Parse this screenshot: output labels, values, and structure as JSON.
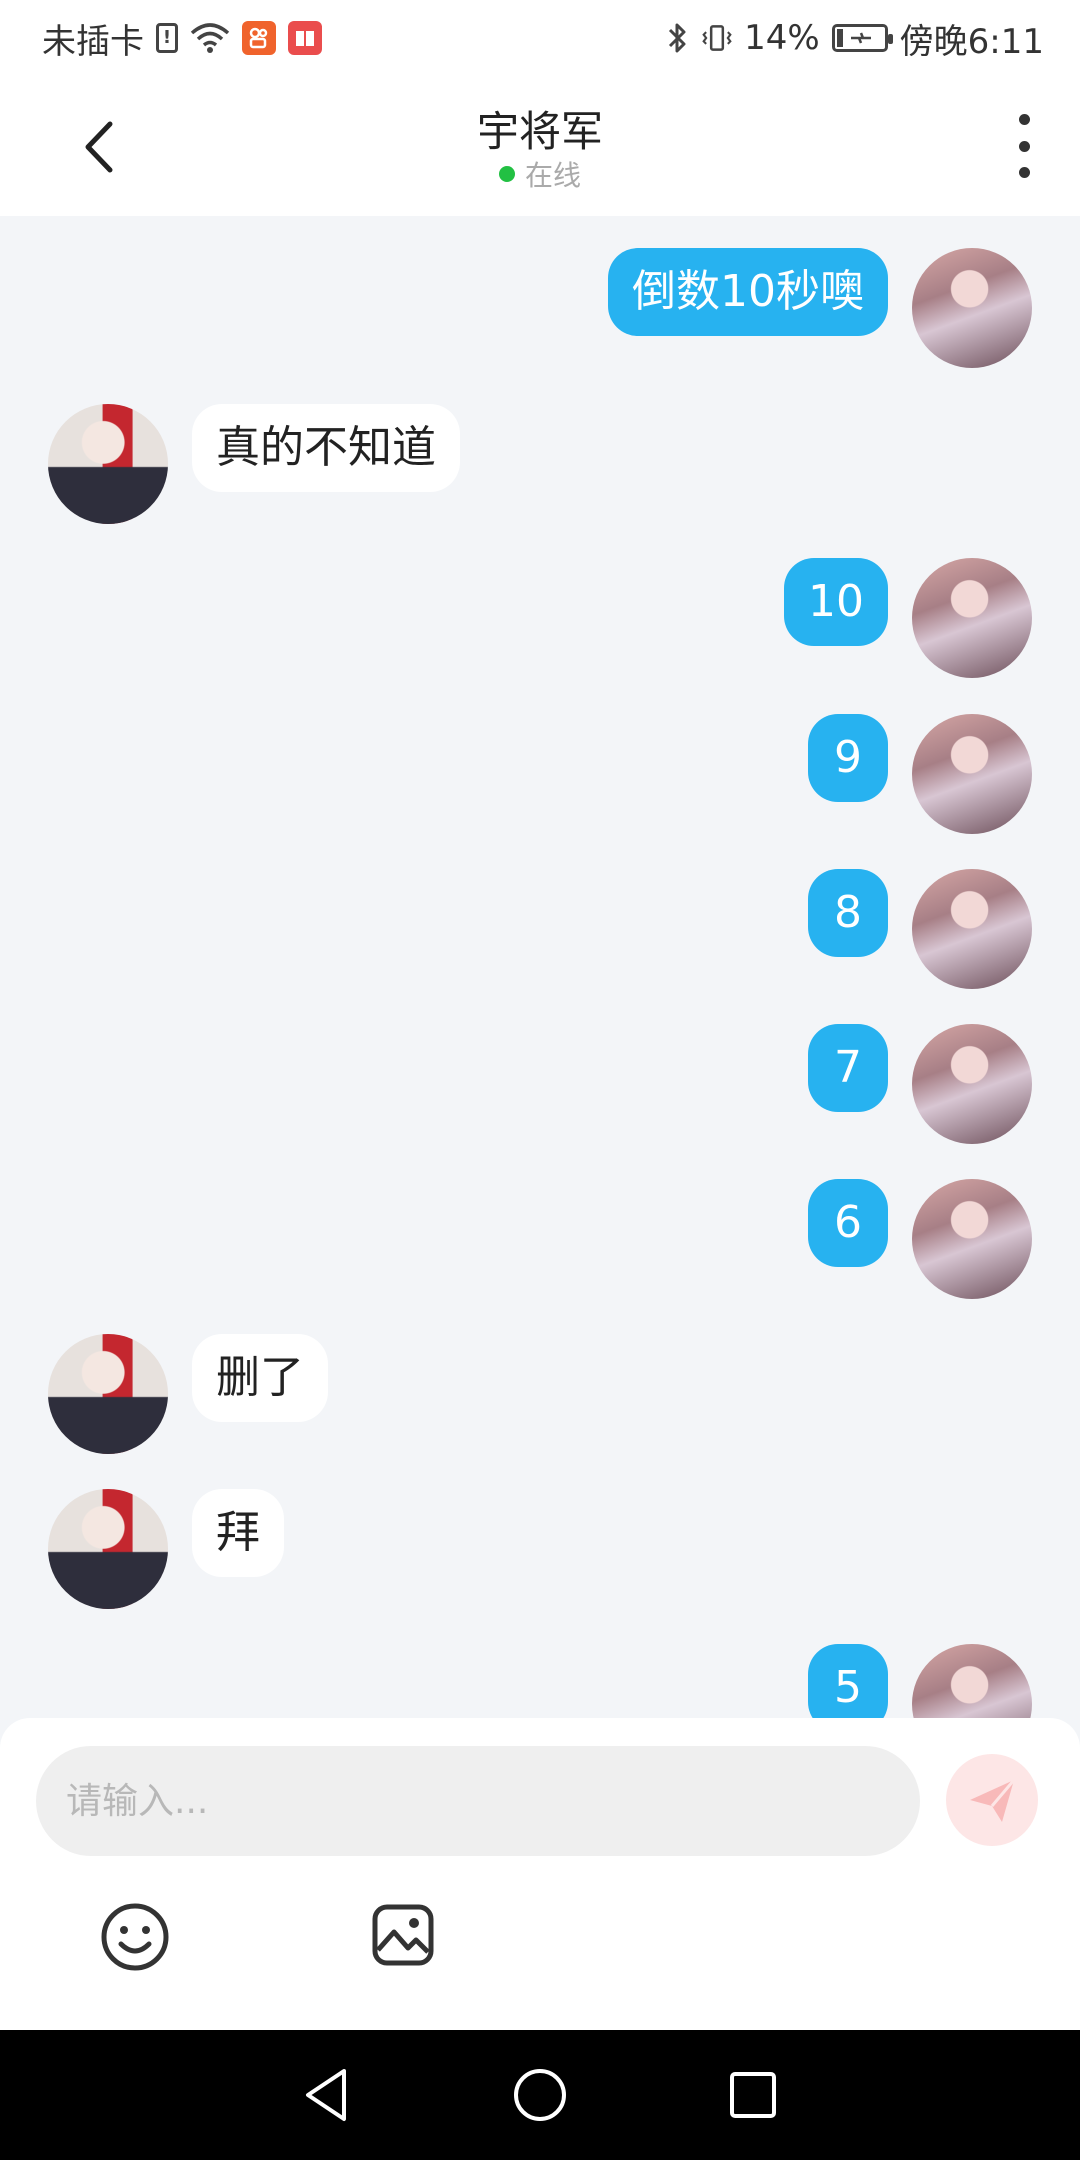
{
  "status_bar": {
    "carrier": "未插卡",
    "bluetooth_icon": "bluetooth-icon",
    "battery_text": "14%",
    "battery_level": 0.14,
    "time": "傍晚6:11"
  },
  "header": {
    "title": "宇将军",
    "status": "在线",
    "status_color": "#22c043"
  },
  "messages": [
    {
      "side": "right",
      "text": "倒数10秒噢"
    },
    {
      "side": "left",
      "text": "真的不知道"
    },
    {
      "side": "right",
      "text": "10"
    },
    {
      "side": "right",
      "text": "9"
    },
    {
      "side": "right",
      "text": "8"
    },
    {
      "side": "right",
      "text": "7"
    },
    {
      "side": "right",
      "text": "6"
    },
    {
      "side": "left",
      "text": "删了"
    },
    {
      "side": "left",
      "text": "拜"
    },
    {
      "side": "right",
      "text": "5"
    }
  ],
  "input": {
    "placeholder": "请输入..."
  },
  "colors": {
    "accent": "#27b2f0",
    "send_button": "#fde6e6",
    "background": "#f3f5f8"
  }
}
